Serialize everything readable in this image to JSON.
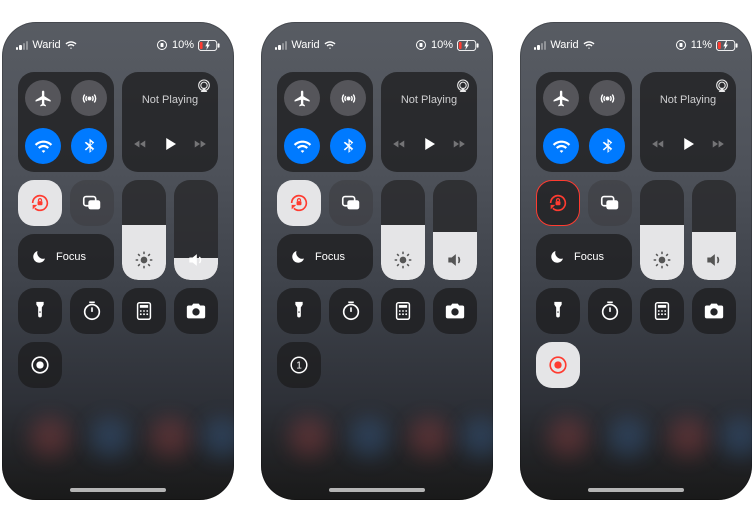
{
  "screens": [
    {
      "status": {
        "carrier": "Warid",
        "signal_active_bars": 2,
        "battery_pct": "10%",
        "charging": true
      },
      "media": {
        "title": "Not Playing"
      },
      "focus_label": "Focus",
      "brightness_fill": 55,
      "volume_fill": 22,
      "record_variant": "idle-dark"
    },
    {
      "status": {
        "carrier": "Warid",
        "signal_active_bars": 2,
        "battery_pct": "10%",
        "charging": true
      },
      "media": {
        "title": "Not Playing"
      },
      "focus_label": "Focus",
      "brightness_fill": 55,
      "volume_fill": 48,
      "record_variant": "countdown",
      "record_count": "1"
    },
    {
      "status": {
        "carrier": "Warid",
        "signal_active_bars": 2,
        "battery_pct": "11%",
        "charging": true
      },
      "media": {
        "title": "Not Playing"
      },
      "focus_label": "Focus",
      "brightness_fill": 55,
      "volume_fill": 48,
      "record_variant": "recording"
    }
  ]
}
